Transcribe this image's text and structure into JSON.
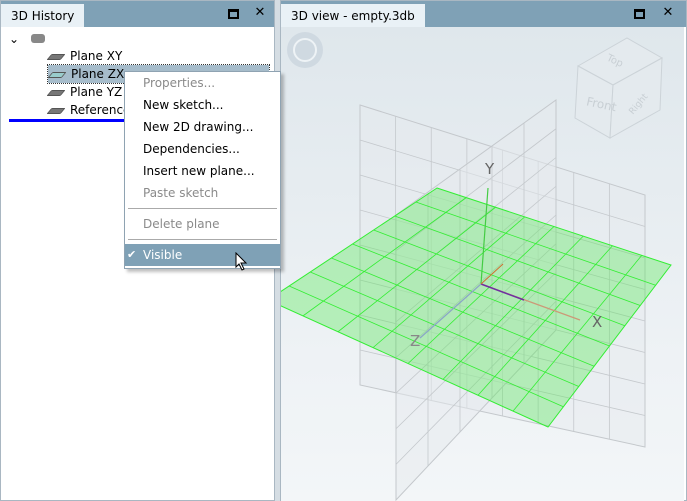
{
  "history_panel": {
    "title": "3D History",
    "root_icon": "part-icon",
    "items": [
      {
        "label": "Plane XY"
      },
      {
        "label": "Plane ZX",
        "selected": true
      },
      {
        "label": "Plane YZ"
      },
      {
        "label": "Reference"
      }
    ]
  },
  "context_menu": {
    "items": [
      {
        "label": "Properties...",
        "enabled": false
      },
      {
        "label": "New sketch...",
        "enabled": true
      },
      {
        "label": "New 2D drawing...",
        "enabled": true
      },
      {
        "label": "Dependencies...",
        "enabled": true
      },
      {
        "label": "Insert new plane...",
        "enabled": true
      },
      {
        "label": "Paste sketch",
        "enabled": false
      },
      {
        "label": "Delete plane",
        "enabled": false
      },
      {
        "label": "Visible",
        "enabled": true,
        "checked": true,
        "highlighted": true
      }
    ]
  },
  "view_panel": {
    "title": "3D view - empty.3db",
    "cube": {
      "top": "Top",
      "front": "Front",
      "right": "Right"
    },
    "axes": {
      "x": "X",
      "y": "Y",
      "z": "Z"
    }
  },
  "colors": {
    "header": "#7fa1b6",
    "plane_green": "#33ee33",
    "accent_blue": "#0000ff"
  }
}
